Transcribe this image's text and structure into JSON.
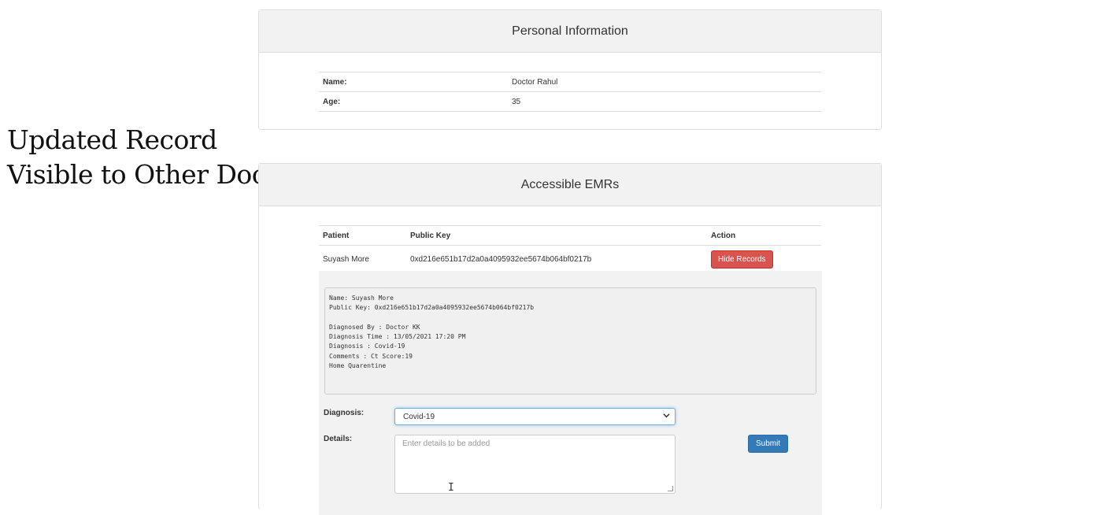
{
  "caption": {
    "line1": "Updated Record",
    "line2": "Visible to Other Doctor"
  },
  "personal_info": {
    "title": "Personal Information",
    "rows": [
      {
        "label": "Name:",
        "value": "Doctor Rahul"
      },
      {
        "label": "Age:",
        "value": "35"
      }
    ]
  },
  "emr": {
    "title": "Accessible EMRs",
    "headers": {
      "patient": "Patient",
      "public_key": "Public Key",
      "action": "Action"
    },
    "rows": [
      {
        "patient": "Suyash More",
        "public_key": "0xd216e651b17d2a0a4095932ee5674b064bf0217b",
        "action_label": "Hide Records"
      }
    ],
    "record": {
      "lines": [
        "Name: Suyash More",
        "Public Key: 0xd216e651b17d2a0a4095932ee5674b064bf0217b",
        "",
        "Diagnosed By : Doctor KK",
        "Diagnosis Time : 13/05/2021 17:20 PM",
        "Diagnosis : Covid-19",
        "Comments : Ct Score:19",
        "Home Quarentine"
      ]
    },
    "form": {
      "diagnosis_label": "Diagnosis:",
      "diagnosis_value": "Covid-19",
      "details_label": "Details:",
      "details_placeholder": "Enter details to be added",
      "submit_label": "Submit"
    }
  },
  "colors": {
    "danger": "#d9534f",
    "primary": "#337ab7",
    "heading_bg": "#f2f2f2"
  }
}
